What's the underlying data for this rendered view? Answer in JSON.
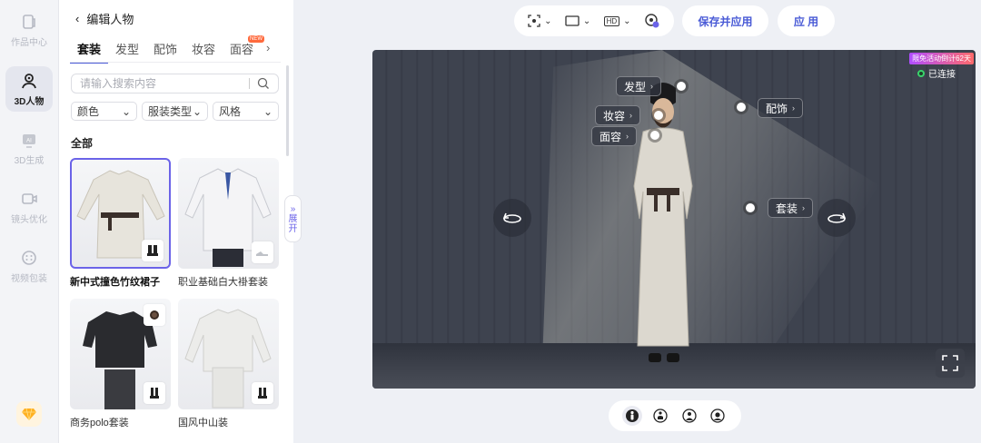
{
  "rail": {
    "items": [
      {
        "label": "作品中心"
      },
      {
        "label": "3D人物"
      },
      {
        "label": "3D生成"
      },
      {
        "label": "镜头优化"
      },
      {
        "label": "视频包装"
      }
    ]
  },
  "panel": {
    "back_label": "编辑人物",
    "tabs": [
      {
        "label": "套装"
      },
      {
        "label": "发型"
      },
      {
        "label": "配饰"
      },
      {
        "label": "妆容"
      },
      {
        "label": "面容",
        "badge": "NEW"
      }
    ],
    "search_placeholder": "请输入搜索内容",
    "filters": [
      {
        "label": "颜色"
      },
      {
        "label": "服装类型"
      },
      {
        "label": "风格"
      }
    ],
    "section_title": "全部",
    "cards": [
      {
        "name": "新中式撞色竹纹裙子"
      },
      {
        "name": "职业基础白大褂套装"
      },
      {
        "name": "商务polo套装"
      },
      {
        "name": "国风中山装"
      }
    ],
    "expand_label_1": "展",
    "expand_label_2": "开"
  },
  "toolbar": {
    "hd_label": "HD",
    "save_apply_label": "保存并应用",
    "apply_label": "应 用"
  },
  "stage": {
    "badge": "限免活动倒计62天",
    "connection_status": "已连接",
    "tags": {
      "hair": "发型",
      "makeup": "妆容",
      "face": "面容",
      "accessory": "配饰",
      "outfit": "套装"
    }
  },
  "colors": {
    "accent": "#4a5bd6",
    "selection": "#6b63e8",
    "stage_bg": "#3e434f",
    "connected": "#39d36b"
  }
}
